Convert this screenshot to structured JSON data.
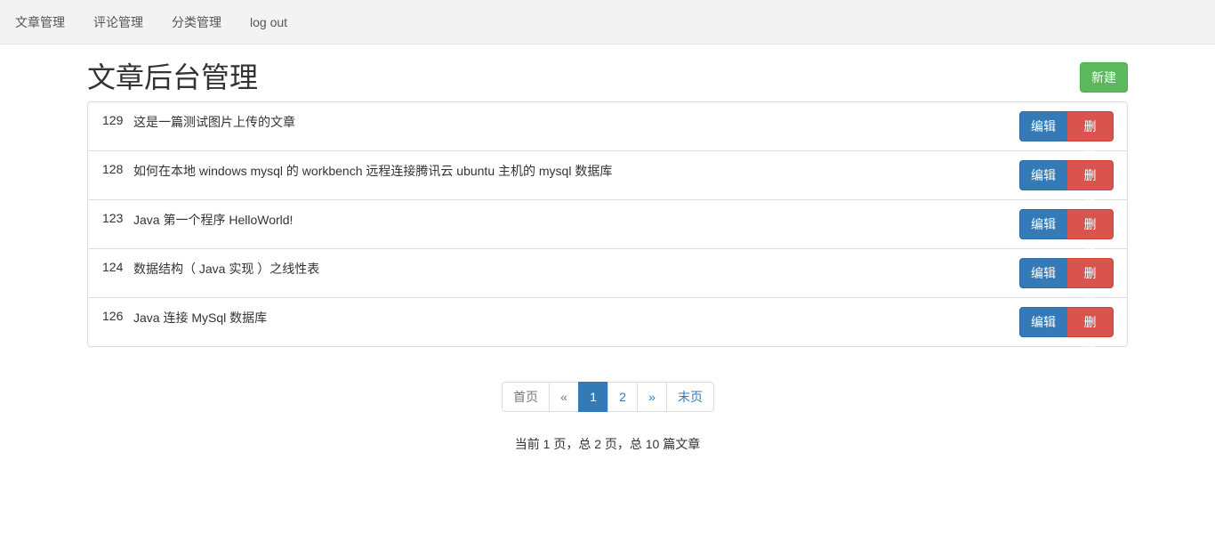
{
  "nav": {
    "items": [
      {
        "label": "文章管理"
      },
      {
        "label": "评论管理"
      },
      {
        "label": "分类管理"
      },
      {
        "label": "log out"
      }
    ]
  },
  "header": {
    "title": "文章后台管理",
    "new_label": "新建"
  },
  "articles": [
    {
      "id": "129",
      "title": "这是一篇测试图片上传的文章",
      "edit_label": "编辑",
      "delete_label": "删除"
    },
    {
      "id": "128",
      "title": "如何在本地 windows mysql 的 workbench 远程连接腾讯云 ubuntu 主机的 mysql 数据库",
      "edit_label": "编辑",
      "delete_label": "删除"
    },
    {
      "id": "123",
      "title": "Java 第一个程序 HelloWorld!",
      "edit_label": "编辑",
      "delete_label": "删除"
    },
    {
      "id": "124",
      "title": "数据结构（ Java 实现 ）之线性表",
      "edit_label": "编辑",
      "delete_label": "删除"
    },
    {
      "id": "126",
      "title": "Java 连接 MySql 数据库",
      "edit_label": "编辑",
      "delete_label": "删除"
    }
  ],
  "pagination": {
    "first": "首页",
    "prev": "«",
    "pages": [
      "1",
      "2"
    ],
    "current": "1",
    "next": "»",
    "last": "末页"
  },
  "summary": "当前 1 页，总 2 页，总 10 篇文章",
  "colors": {
    "primary": "#337ab7",
    "success": "#5cb85c",
    "danger": "#d9534f",
    "navbar": "#f3f3f3"
  }
}
